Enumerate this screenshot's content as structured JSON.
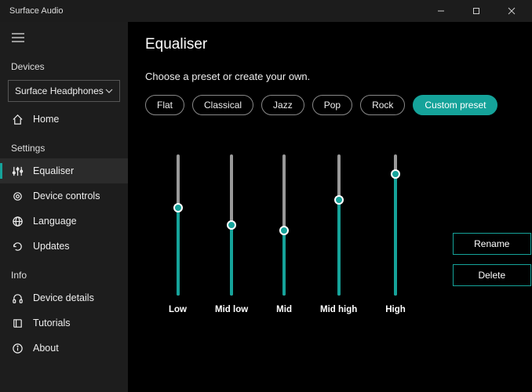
{
  "titlebar": {
    "title": "Surface Audio"
  },
  "sidebar": {
    "devices_label": "Devices",
    "device_selected": "Surface Headphones",
    "home": "Home",
    "settings_label": "Settings",
    "equaliser": "Equaliser",
    "device_controls": "Device controls",
    "language": "Language",
    "updates": "Updates",
    "info_label": "Info",
    "device_details": "Device details",
    "tutorials": "Tutorials",
    "about": "About"
  },
  "main": {
    "title": "Equaliser",
    "subtitle": "Choose a preset or create your own.",
    "presets": {
      "flat": "Flat",
      "classical": "Classical",
      "jazz": "Jazz",
      "pop": "Pop",
      "rock": "Rock",
      "custom": "Custom preset"
    },
    "bands": {
      "low": {
        "label": "Low",
        "value": 62
      },
      "midlow": {
        "label": "Mid low",
        "value": 50
      },
      "mid": {
        "label": "Mid",
        "value": 46
      },
      "midhigh": {
        "label": "Mid high",
        "value": 68
      },
      "high": {
        "label": "High",
        "value": 86
      }
    },
    "actions": {
      "rename": "Rename",
      "delete": "Delete"
    }
  },
  "colors": {
    "accent": "#15a39a"
  }
}
